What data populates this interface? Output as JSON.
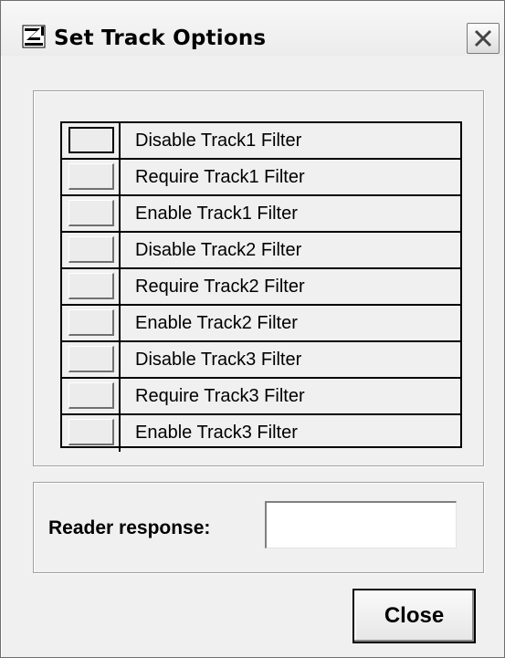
{
  "window": {
    "title": "Set Track Options",
    "icon": "app-logo-icon",
    "close_icon": "close-x-icon"
  },
  "track_options": [
    {
      "label": "Disable Track1 Filter"
    },
    {
      "label": "Require Track1 Filter"
    },
    {
      "label": "Enable Track1 Filter"
    },
    {
      "label": "Disable Track2 Filter"
    },
    {
      "label": "Require Track2 Filter"
    },
    {
      "label": "Enable Track2 Filter"
    },
    {
      "label": "Disable Track3 Filter"
    },
    {
      "label": "Require Track3 Filter"
    },
    {
      "label": "Enable Track3 Filter"
    }
  ],
  "response": {
    "label": "Reader response:",
    "value": ""
  },
  "buttons": {
    "close": "Close"
  }
}
